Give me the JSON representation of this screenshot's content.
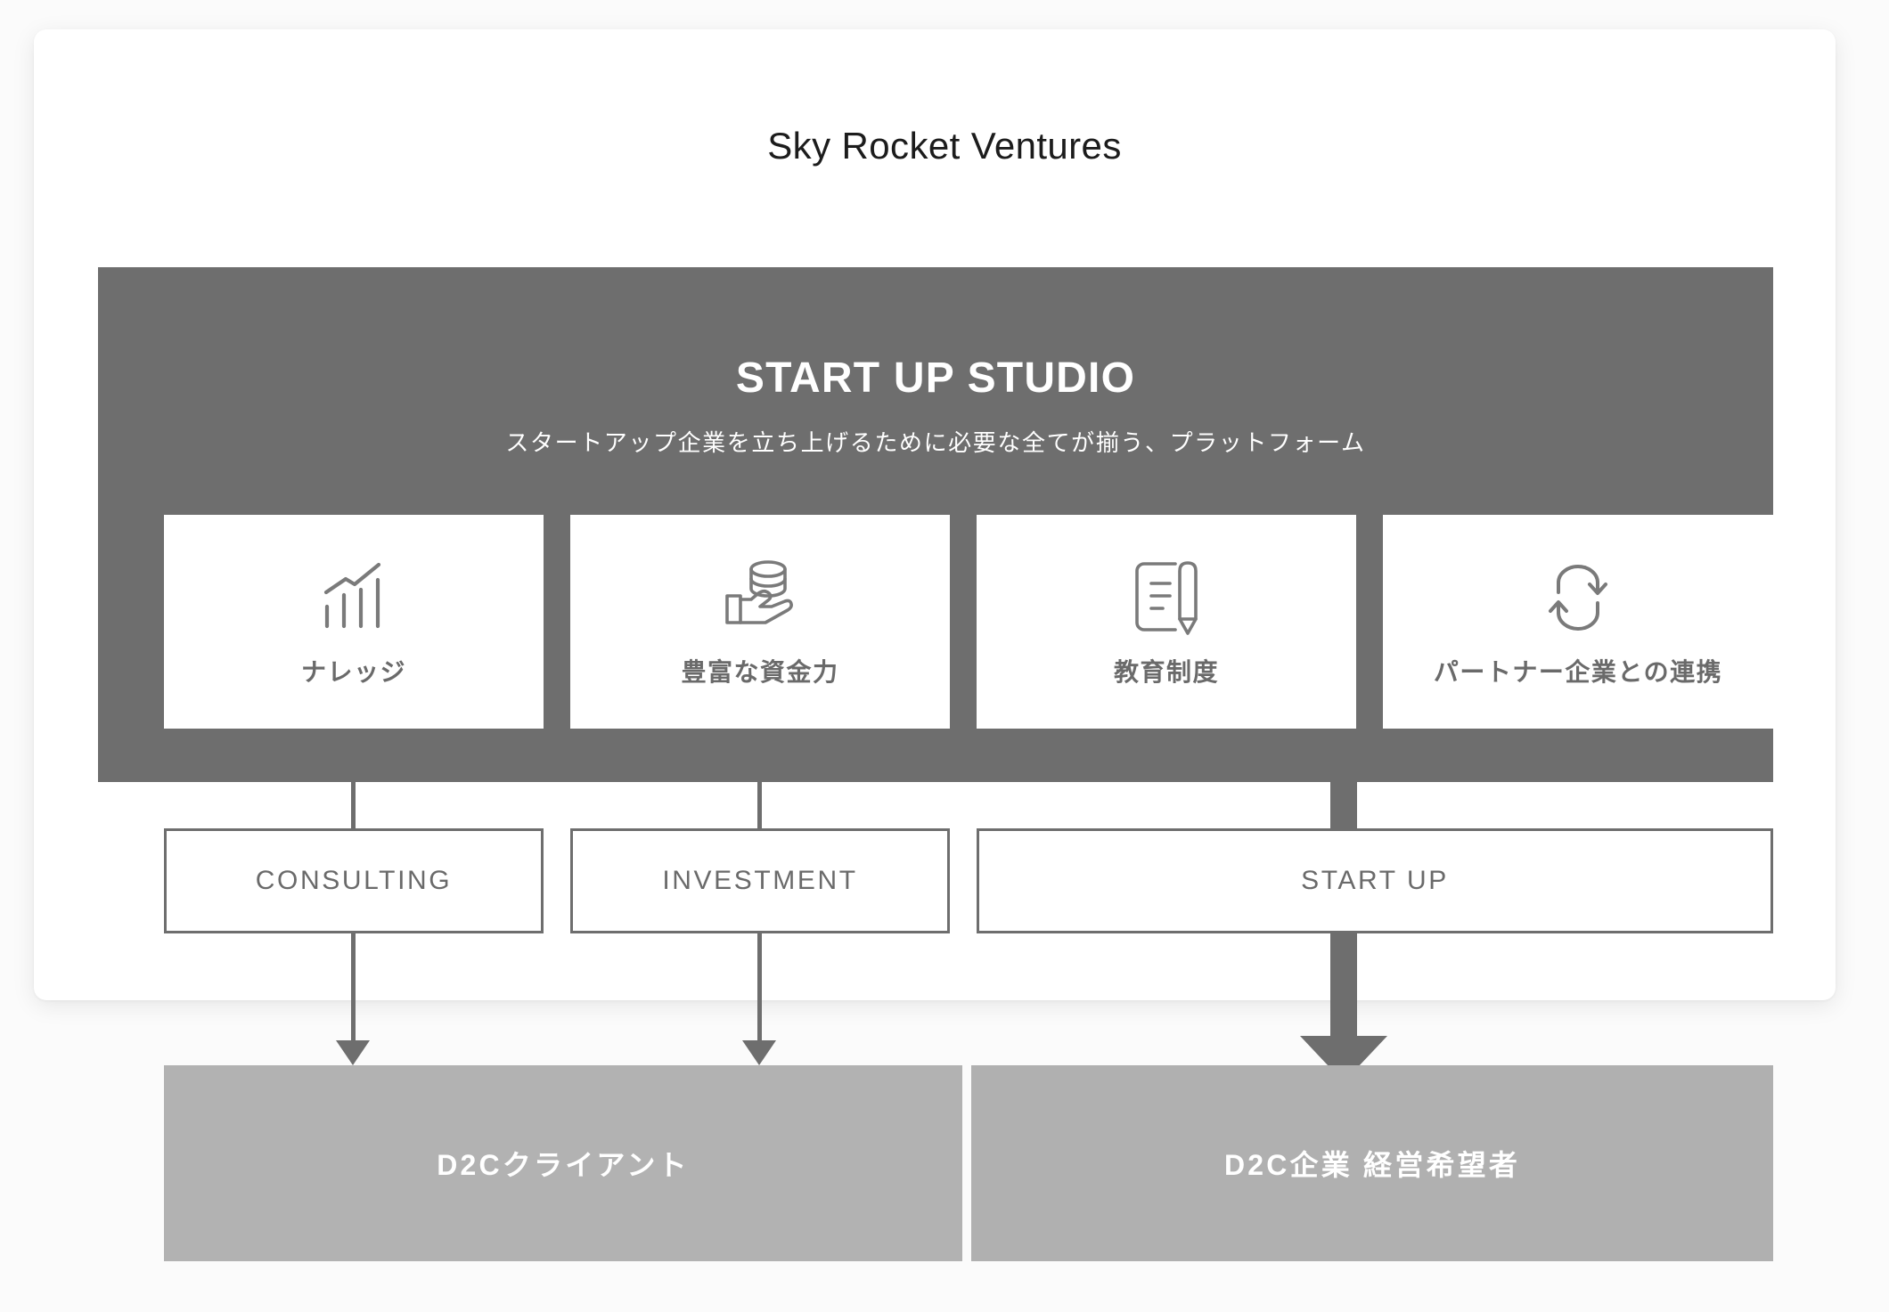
{
  "page": {
    "title": "Sky Rocket Ventures",
    "background_color": "#fbfbfb",
    "card_color": "#ffffff"
  },
  "studio": {
    "heading": "START UP STUDIO",
    "subheading": "スタートアップ企業を立ち上げるために必要な全てが揃う、プラットフォーム",
    "panel_color": "#6e6e6e",
    "text_color": "#ffffff",
    "features": [
      {
        "label": "ナレッジ",
        "icon": "bar-chart-trend-icon"
      },
      {
        "label": "豊富な資金力",
        "icon": "hand-holding-coins-icon"
      },
      {
        "label": "教育制度",
        "icon": "document-pencil-icon"
      },
      {
        "label": "パートナー企業との連携",
        "icon": "sync-loop-arrows-icon"
      }
    ]
  },
  "mid_boxes": [
    {
      "label": "CONSULTING"
    },
    {
      "label": "INVESTMENT"
    },
    {
      "label": "START UP"
    }
  ],
  "bottom_boxes": [
    {
      "label": "D2Cクライアント",
      "color": "#b2b2b2"
    },
    {
      "label": "D2C企業 経営希望者",
      "color": "#b0b0b0"
    }
  ],
  "colors": {
    "dark_gray": "#6e6e6e",
    "mid_gray": "#b2b2b2",
    "icon_stroke": "#7a7a7a",
    "label_gray": "#6a6a6a"
  }
}
